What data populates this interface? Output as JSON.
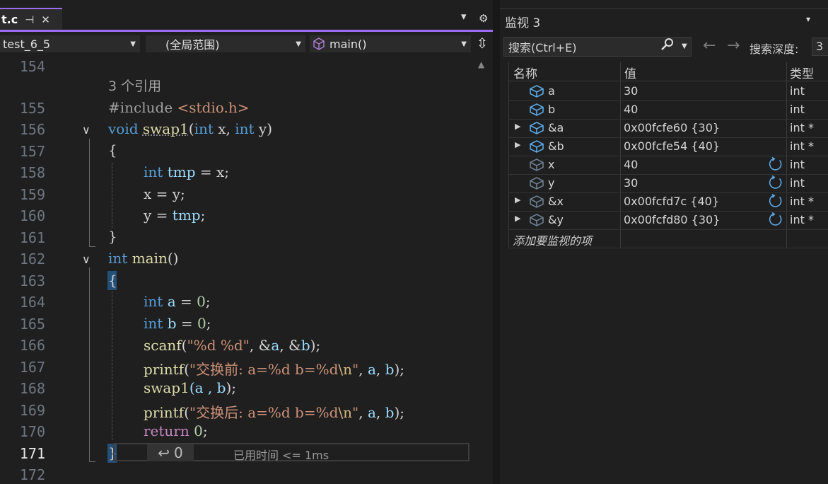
{
  "editor": {
    "tab": {
      "title": "t.c",
      "pin": "⊣",
      "close": "✕"
    },
    "tabstrip_menu": "▾",
    "tabstrip_gear": "⚙",
    "nav": {
      "project": "test_6_5",
      "scope": "(全局范围)",
      "member": "main()"
    },
    "lines": [
      {
        "n": "154"
      },
      {
        "n": "155"
      },
      {
        "n": "156"
      },
      {
        "n": "157"
      },
      {
        "n": "158"
      },
      {
        "n": "159"
      },
      {
        "n": "160"
      },
      {
        "n": "161"
      },
      {
        "n": "162"
      },
      {
        "n": "163"
      },
      {
        "n": "164"
      },
      {
        "n": "165"
      },
      {
        "n": "166"
      },
      {
        "n": "167"
      },
      {
        "n": "168"
      },
      {
        "n": "169"
      },
      {
        "n": "170"
      },
      {
        "n": "171"
      },
      {
        "n": "172"
      }
    ],
    "codelens": "3 个引用",
    "code": {
      "l155_pp": "#include ",
      "l155_hdr": "<stdio.h>",
      "kw_void": "void",
      "fn_swap1": "swap1",
      "paren_open": "(",
      "kw_int": "int",
      "p_x": " x, ",
      "p_y": " y)",
      "brace_open": "{",
      "brace_close": "}",
      "tmp": "tmp",
      "eq_x": " = x;",
      "x_eq_y": "x = y;",
      "y_eq": "y = ",
      "semi": ";",
      "fn_main": "main",
      "main_parens": "()",
      "var_a": "a",
      "var_b": "b",
      "eq_0": " = ",
      "zero": "0",
      "fn_scanf": "scanf",
      "scanf_str": "\"%d %d\"",
      "scanf_args_1": ", &",
      "scanf_args_2": ", &",
      "scanf_end": ");",
      "fn_printf": "printf",
      "printf1_str_a": "\"交换前: a=%d b=%d",
      "printf2_str_a": "\"交换后: a=%d b=%d",
      "printf_esc": "\\n",
      "printf_quote": "\"",
      "comma_sp": ", ",
      "printf_end": ");",
      "swap_call_a": "(a , ",
      "swap_call_end": ");",
      "kw_return": "return",
      "ret_end": ";"
    },
    "perf_tip": {
      "return_value": "0",
      "time": "已用时间 <= 1ms"
    }
  },
  "watch": {
    "title": "监视 3",
    "menu": "▾",
    "search_placeholder": "搜索(Ctrl+E)",
    "depth_label": "搜索深度:",
    "depth_value": "3",
    "back_arrow": "←",
    "forward_arrow": "→",
    "columns": {
      "name": "名称",
      "value": "值",
      "type": "类型"
    },
    "rows": [
      {
        "name": "a",
        "value": "30",
        "type": "int",
        "expandable": false,
        "stale": false
      },
      {
        "name": "b",
        "value": "40",
        "type": "int",
        "expandable": false,
        "stale": false
      },
      {
        "name": "&a",
        "value": "0x00fcfe60 {30}",
        "type": "int *",
        "expandable": true,
        "stale": false
      },
      {
        "name": "&b",
        "value": "0x00fcfe54 {40}",
        "type": "int *",
        "expandable": true,
        "stale": false
      },
      {
        "name": "x",
        "value": "40",
        "type": "int",
        "expandable": false,
        "stale": true
      },
      {
        "name": "y",
        "value": "30",
        "type": "int",
        "expandable": false,
        "stale": true
      },
      {
        "name": "&x",
        "value": "0x00fcfd7c {40}",
        "type": "int *",
        "expandable": true,
        "stale": true
      },
      {
        "name": "&y",
        "value": "0x00fcfd80 {30}",
        "type": "int *",
        "expandable": true,
        "stale": true
      }
    ],
    "add_item": "添加要监视的项"
  },
  "colors": {
    "accent": "#9c6bf2",
    "keyword": "#569cd6",
    "function": "#dcdcaa",
    "variable": "#9cdcfe",
    "string": "#ce9178",
    "number": "#b5cea8",
    "icon_active": "#5aa9e6",
    "icon_stale": "#6d7f90"
  }
}
